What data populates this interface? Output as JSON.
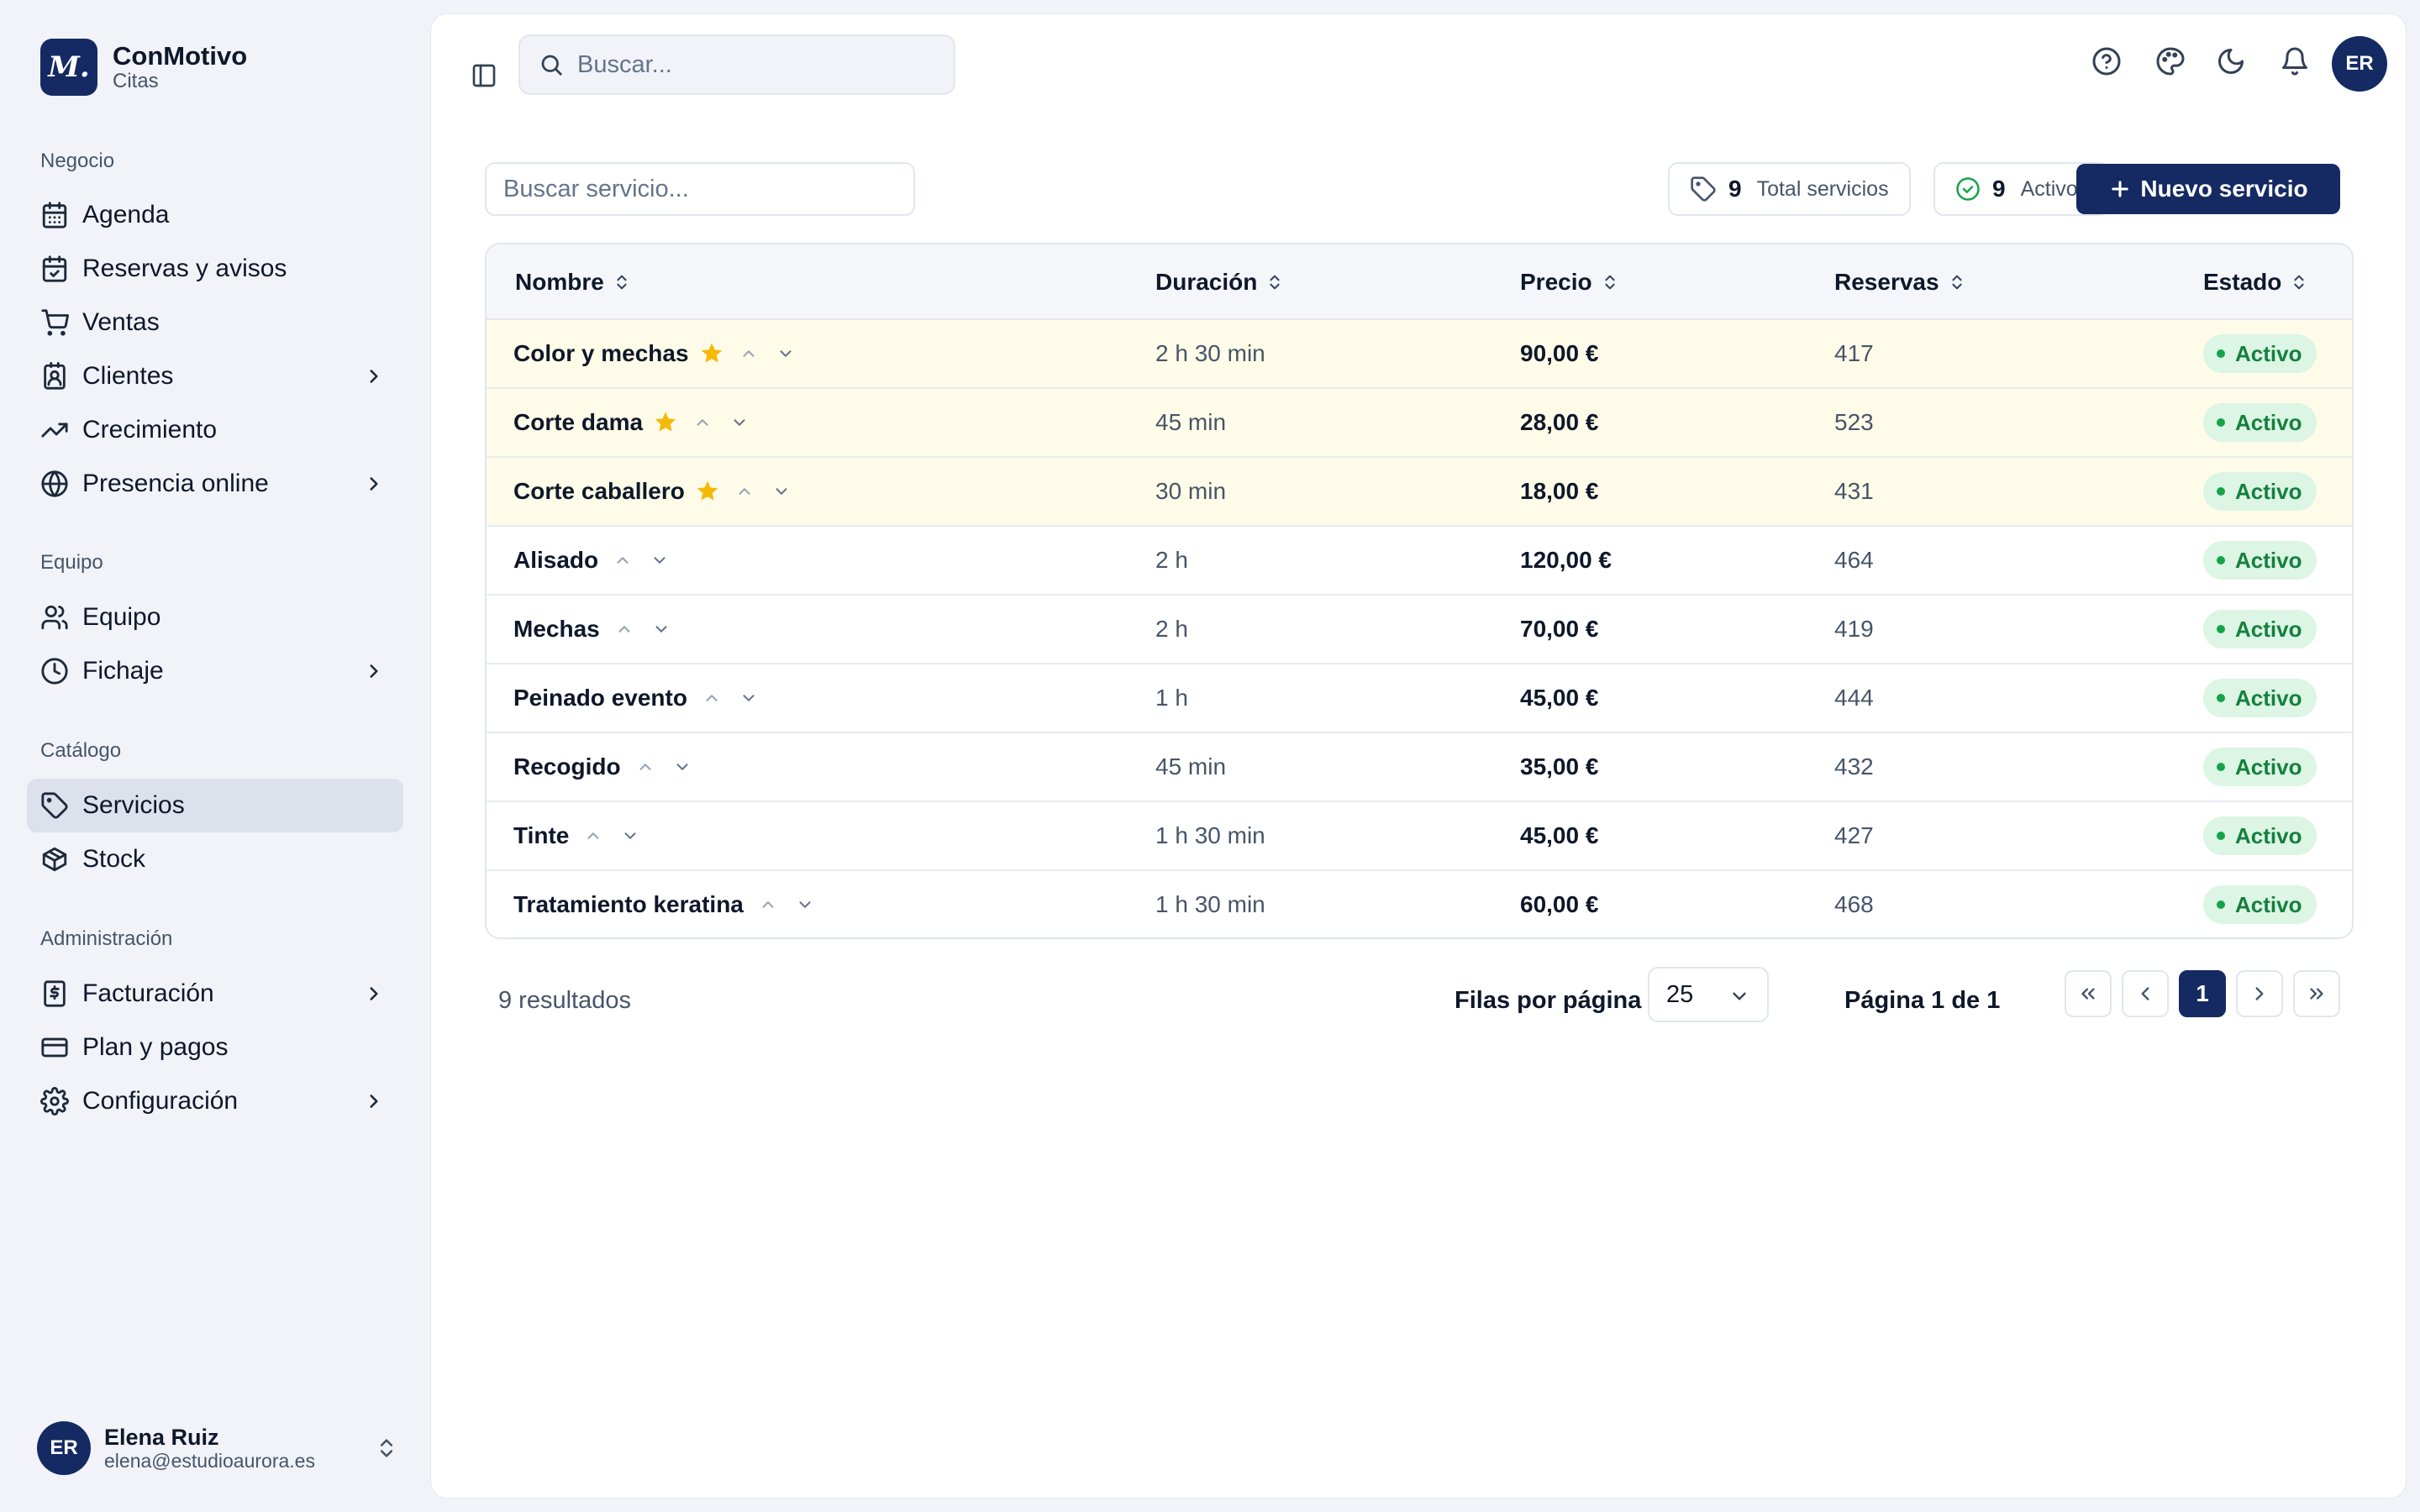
{
  "brand": {
    "logo": "M.",
    "name": "ConMotivo",
    "subtitle": "Citas"
  },
  "sidebar": {
    "groups": [
      {
        "title": "Negocio",
        "items": [
          {
            "label": "Agenda",
            "icon": "calendar-icon"
          },
          {
            "label": "Reservas y avisos",
            "icon": "calendar-check-icon"
          },
          {
            "label": "Ventas",
            "icon": "cart-icon"
          },
          {
            "label": "Clientes",
            "icon": "contact-icon",
            "chevron": true
          },
          {
            "label": "Crecimiento",
            "icon": "trending-up-icon"
          },
          {
            "label": "Presencia online",
            "icon": "globe-icon",
            "chevron": true
          }
        ]
      },
      {
        "title": "Equipo",
        "items": [
          {
            "label": "Equipo",
            "icon": "users-icon"
          },
          {
            "label": "Fichaje",
            "icon": "clock-icon",
            "chevron": true
          }
        ]
      },
      {
        "title": "Catálogo",
        "items": [
          {
            "label": "Servicios",
            "icon": "tag-icon",
            "active": true
          },
          {
            "label": "Stock",
            "icon": "package-icon"
          }
        ]
      },
      {
        "title": "Administración",
        "items": [
          {
            "label": "Facturación",
            "icon": "receipt-icon",
            "chevron": true
          },
          {
            "label": "Plan y pagos",
            "icon": "credit-card-icon"
          },
          {
            "label": "Configuración",
            "icon": "settings-icon",
            "chevron": true
          }
        ]
      }
    ],
    "user": {
      "initials": "ER",
      "name": "Elena Ruiz",
      "email": "elena@estudioaurora.es"
    }
  },
  "header": {
    "search_placeholder": "Buscar...",
    "avatar_initials": "ER",
    "icons": [
      "help-icon",
      "palette-icon",
      "moon-icon",
      "bell-icon"
    ]
  },
  "toolbar": {
    "service_search_placeholder": "Buscar servicio...",
    "total": {
      "value": "9",
      "label": "Total servicios"
    },
    "active": {
      "value": "9",
      "label": "Activos"
    },
    "new_button": "Nuevo servicio"
  },
  "table": {
    "columns": [
      "Nombre",
      "Duración",
      "Precio",
      "Reservas",
      "Estado"
    ],
    "rows": [
      {
        "name": "Color y mechas",
        "duration": "2 h 30 min",
        "price": "90,00 €",
        "bookings": "417",
        "status": "Activo",
        "featured": true
      },
      {
        "name": "Corte dama",
        "duration": "45 min",
        "price": "28,00 €",
        "bookings": "523",
        "status": "Activo",
        "featured": true
      },
      {
        "name": "Corte caballero",
        "duration": "30 min",
        "price": "18,00 €",
        "bookings": "431",
        "status": "Activo",
        "featured": true
      },
      {
        "name": "Alisado",
        "duration": "2 h",
        "price": "120,00 €",
        "bookings": "464",
        "status": "Activo",
        "featured": false
      },
      {
        "name": "Mechas",
        "duration": "2 h",
        "price": "70,00 €",
        "bookings": "419",
        "status": "Activo",
        "featured": false
      },
      {
        "name": "Peinado evento",
        "duration": "1 h",
        "price": "45,00 €",
        "bookings": "444",
        "status": "Activo",
        "featured": false
      },
      {
        "name": "Recogido",
        "duration": "45 min",
        "price": "35,00 €",
        "bookings": "432",
        "status": "Activo",
        "featured": false
      },
      {
        "name": "Tinte",
        "duration": "1 h 30 min",
        "price": "45,00 €",
        "bookings": "427",
        "status": "Activo",
        "featured": false
      },
      {
        "name": "Tratamiento keratina",
        "duration": "1 h 30 min",
        "price": "60,00 €",
        "bookings": "468",
        "status": "Activo",
        "featured": false
      }
    ]
  },
  "footer": {
    "results": "9 resultados",
    "rows_per_page_label": "Filas por página",
    "rows_per_page_value": "25",
    "page_label": "Página 1 de 1",
    "current_page": "1"
  },
  "colors": {
    "accent": "#152a63",
    "featured_row": "#fefce8",
    "status_bg": "#dcf5e4",
    "status_text": "#15803d",
    "star": "#f5b90a"
  }
}
